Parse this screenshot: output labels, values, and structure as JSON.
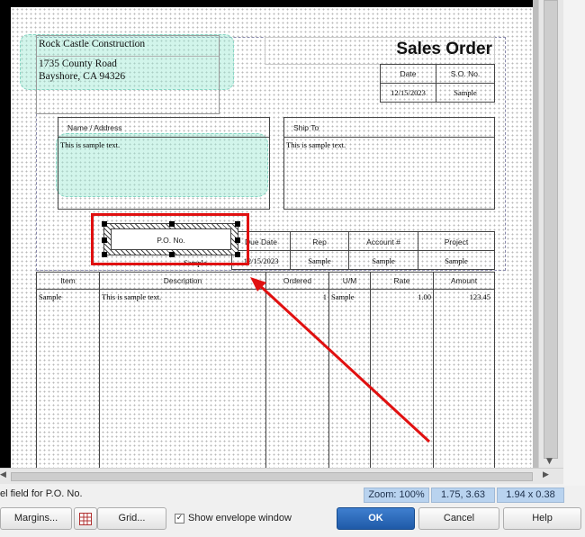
{
  "company": {
    "name": "Rock Castle Construction",
    "address_line1": "1735 County Road",
    "address_line2": "Bayshore, CA 94326"
  },
  "form": {
    "title": "Sales Order",
    "date_header": "Date",
    "so_header": "S.O. No.",
    "date_value": "12/15/2023",
    "so_value": "Sample",
    "name_address_label": "Name / Address",
    "name_address_text": "This is sample text.",
    "ship_to_label": "Ship To",
    "ship_to_text": "This is sample text.",
    "po_label": "P.O. No.",
    "po_value": "Sample",
    "due_date_label": "Due Date",
    "due_date_value": "12/15/2023",
    "rep_label": "Rep",
    "rep_value": "Sample",
    "account_label": "Account #",
    "account_value": "Sample",
    "project_label": "Project",
    "project_value": "Sample"
  },
  "table": {
    "columns": [
      "Item",
      "Description",
      "Ordered",
      "U/M",
      "Rate",
      "Amount"
    ],
    "row": {
      "item": "Sample",
      "description": "This is sample text.",
      "ordered": "1",
      "um": "Sample",
      "rate": "1.00",
      "amount": "123.45"
    }
  },
  "status": {
    "field_text": "el field for P.O. No.",
    "zoom": "Zoom: 100%",
    "position": "1.75, 3.63",
    "size": "1.94 x 0.38"
  },
  "buttons": {
    "margins": "Margins...",
    "grid": "Grid...",
    "show_envelope": "Show envelope window",
    "ok": "OK",
    "cancel": "Cancel",
    "help": "Help"
  },
  "colors": {
    "highlight_red": "#e01010",
    "teal_field": "#9be8d2",
    "ok_blue": "#2563b8",
    "status_blue": "#b9d3ef"
  },
  "icons": {
    "grid": "grid-icon",
    "checkbox": "checkbox-checked-icon",
    "arrow": "red-arrow-annotation"
  }
}
